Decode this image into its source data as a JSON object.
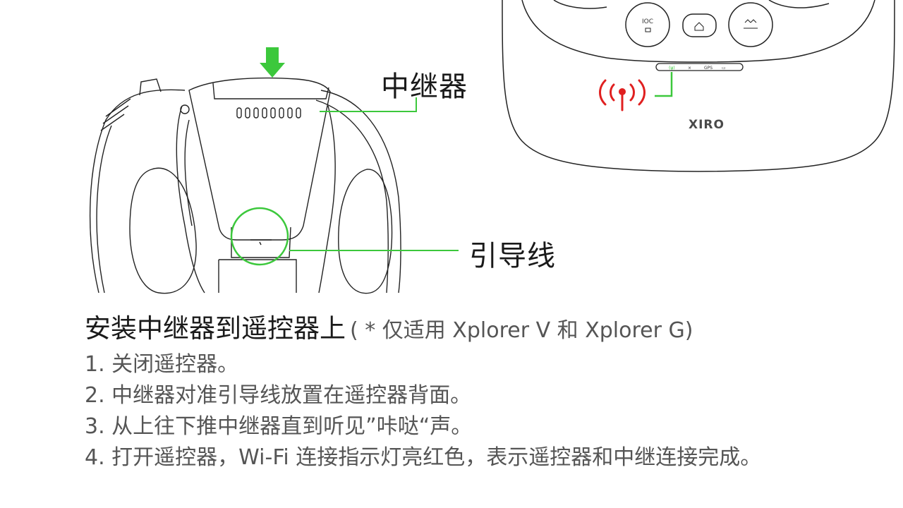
{
  "callouts": {
    "relay": "中继器",
    "guide_line": "引导线"
  },
  "remote": {
    "logo": "XIRO",
    "btn_ioc": "IOC",
    "indicator_labels": [
      "(ψ)",
      "⨯",
      "GPS",
      "▭"
    ]
  },
  "colors": {
    "accent_green": "#3cc83c",
    "signal_red": "#e02020",
    "line": "#222222"
  },
  "instructions": {
    "title": "安装中继器到遥控器上",
    "note": "( * 仅适用 Xplorer V 和 Xplorer G)",
    "steps": [
      "1. 关闭遥控器。",
      "2. 中继器对准引导线放置在遥控器背面。",
      "3. 从上往下推中继器直到听见”咔哒“声。",
      "4. 打开遥控器，Wi-Fi 连接指示灯亮红色，表示遥控器和中继连接完成。"
    ]
  }
}
